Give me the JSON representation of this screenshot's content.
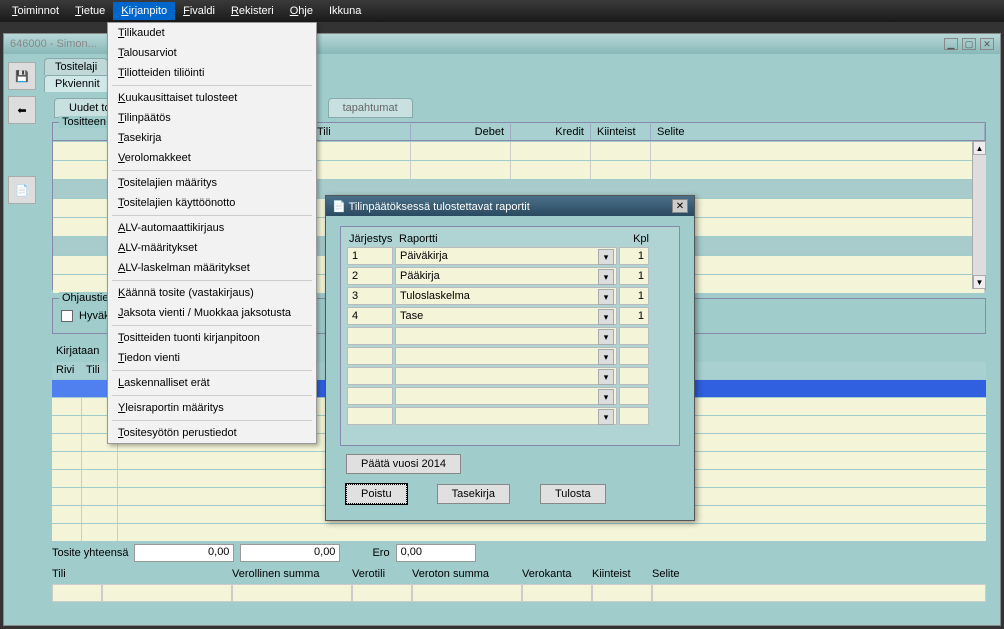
{
  "menubar": {
    "items": [
      {
        "pre": "T",
        "rest": "oiminnot"
      },
      {
        "pre": "T",
        "rest": "ietue"
      },
      {
        "pre": "K",
        "rest": "irjanpito"
      },
      {
        "pre": "F",
        "rest": "ivaldi"
      },
      {
        "pre": "R",
        "rest": "ekisteri"
      },
      {
        "pre": "O",
        "rest": "hje"
      },
      {
        "pre": "",
        "rest": "Ikkuna"
      }
    ]
  },
  "window_title": "646000 - Simon...",
  "icons": {
    "save": "💾",
    "back": "⬅",
    "doc": "📄"
  },
  "top_tabs": {
    "tab1": "Tositelaji",
    "tab2": "Pkviennit"
  },
  "subtabs": {
    "left": "Uudet to",
    "right": "tapahtumat"
  },
  "upper_grid": {
    "label": "Tositteen p",
    "headers": [
      "",
      "Tili",
      "Debet",
      "Kredit",
      "Kiinteist",
      "Selite"
    ]
  },
  "ohjaus": {
    "label": "Ohjaustie",
    "chk_label": "Hyväk"
  },
  "kirjataan": "Kirjataan",
  "lower_grid": {
    "headers": [
      "Rivi",
      "Tili",
      "",
      "p"
    ]
  },
  "totals": {
    "label": "Tosite yhteensä",
    "debet": "0,00",
    "kredit": "0,00",
    "ero_label": "Ero",
    "ero": "0,00"
  },
  "totals2_headers": [
    "Tili",
    "",
    "Verollinen summa",
    "Verotili",
    "Veroton summa",
    "Verokanta",
    "Kiinteist",
    "Selite"
  ],
  "dropdown": [
    {
      "pre": "T",
      "rest": "ilikaudet"
    },
    {
      "pre": "T",
      "rest": "alousarviot"
    },
    {
      "pre": "T",
      "rest": "iliotteiden tiliöinti"
    },
    {
      "sep": true
    },
    {
      "pre": "K",
      "rest": "uukausittaiset tulosteet"
    },
    {
      "pre": "T",
      "rest": "ilinpäätös"
    },
    {
      "pre": "T",
      "rest": "asekirja"
    },
    {
      "pre": "V",
      "rest": "erolomakkeet"
    },
    {
      "sep": true
    },
    {
      "pre": "T",
      "rest": "ositelajien määritys"
    },
    {
      "pre": "T",
      "rest": "ositelajien käyttöönotto"
    },
    {
      "sep": true
    },
    {
      "pre": "A",
      "rest": "LV-automaattikirjaus"
    },
    {
      "pre": "A",
      "rest": "LV-määritykset"
    },
    {
      "pre": "A",
      "rest": "LV-laskelman määritykset"
    },
    {
      "sep": true
    },
    {
      "pre": "K",
      "rest": "äännä tosite (vastakirjaus)"
    },
    {
      "pre": "J",
      "rest": "aksota vienti / Muokkaa jaksotusta"
    },
    {
      "sep": true
    },
    {
      "pre": "T",
      "rest": "ositteiden tuonti kirjanpitoon"
    },
    {
      "pre": "T",
      "rest": "iedon vienti"
    },
    {
      "sep": true
    },
    {
      "pre": "L",
      "rest": "askennalliset erät"
    },
    {
      "sep": true
    },
    {
      "pre": "Y",
      "rest": "leisraportin määritys"
    },
    {
      "sep": true
    },
    {
      "pre": "T",
      "rest": "ositesyötön perustiedot"
    }
  ],
  "dialog": {
    "title": "Tilinpäätöksessä tulostettavat raportit",
    "col1": "Järjestys",
    "col2": "Raportti",
    "col3": "Kpl",
    "rows": [
      {
        "n": "1",
        "r": "Päiväkirja",
        "k": "1"
      },
      {
        "n": "2",
        "r": "Pääkirja",
        "k": "1"
      },
      {
        "n": "3",
        "r": "Tuloslaskelma",
        "k": "1"
      },
      {
        "n": "4",
        "r": "Tase",
        "k": "1"
      }
    ],
    "paata": "Päätä vuosi 2014",
    "btn_poistu": "Poistu",
    "btn_tase": "Tasekirja",
    "btn_tulosta": "Tulosta"
  }
}
